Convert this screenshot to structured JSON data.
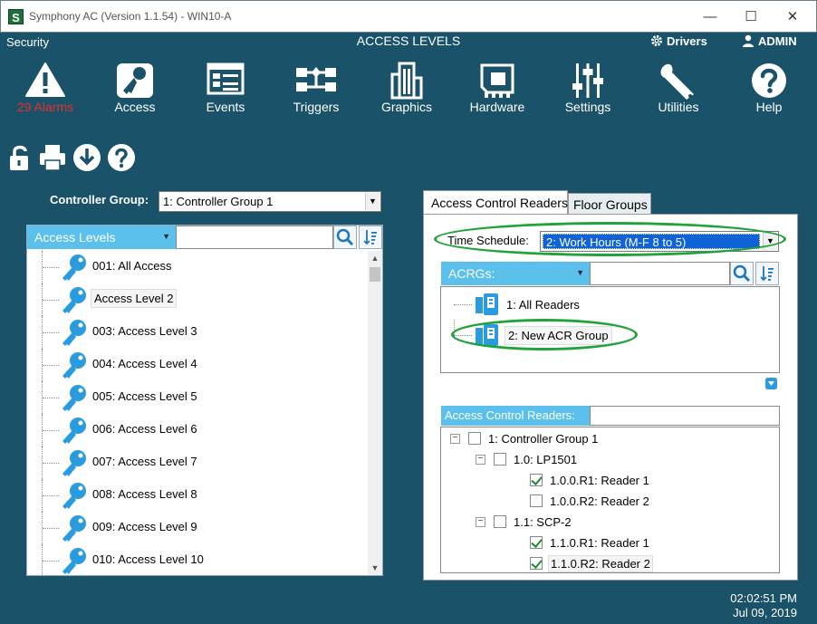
{
  "window": {
    "logo_letter": "S",
    "title": "Symphony AC  (Version 1.1.54) - WIN10-A",
    "min_glyph": "—",
    "max_glyph": "☐",
    "close_glyph": "✕"
  },
  "header": {
    "section": "Security",
    "page_title": "ACCESS LEVELS",
    "drivers": "Drivers",
    "admin": "ADMIN"
  },
  "toolbar": {
    "alarms": "29 Alarms",
    "access": "Access",
    "events": "Events",
    "triggers": "Triggers",
    "graphics": "Graphics",
    "hardware": "Hardware",
    "settings": "Settings",
    "utilities": "Utilities",
    "help": "Help"
  },
  "controller_group": {
    "label": "Controller Group:",
    "value": "1:  Controller Group 1"
  },
  "access_levels": {
    "header": "Access Levels",
    "items": [
      "001: All Access",
      "Access Level 2",
      "003: Access Level 3",
      "004: Access Level 4",
      "005: Access Level 5",
      "006: Access Level 6",
      "007: Access Level 7",
      "008: Access Level 8",
      "009: Access Level 9",
      "010: Access Level 10"
    ]
  },
  "tabs": {
    "acr": "Access Control Readers",
    "floor": "Floor Groups"
  },
  "time_schedule": {
    "label": "Time Schedule:",
    "value": "2:  Work Hours (M-F 8 to 5)"
  },
  "acrgs": {
    "header": "ACRGs:",
    "items": [
      "1: All Readers",
      "2: New ACR Group"
    ]
  },
  "readers": {
    "header": "Access Control Readers:",
    "nodes": [
      {
        "label": "1:  Controller Group 1",
        "checked": false
      },
      {
        "label": "1.0:  LP1501",
        "checked": false
      },
      {
        "label": "1.0.0.R1: Reader 1",
        "checked": true
      },
      {
        "label": "1.0.0.R2: Reader 2",
        "checked": false
      },
      {
        "label": "1.1:  SCP-2",
        "checked": false
      },
      {
        "label": "1.1.0.R1: Reader 1",
        "checked": true
      },
      {
        "label": "1.1.0.R2: Reader 2",
        "checked": true
      }
    ]
  },
  "clock": {
    "time": "02:02:51 PM",
    "date": "Jul 09, 2019"
  },
  "colors": {
    "background": "#1a5369",
    "panel_header": "#5bc0eb",
    "key_icon": "#2b9be0",
    "highlight_oval": "#1fa33a",
    "alarm_text": "#e23030"
  }
}
